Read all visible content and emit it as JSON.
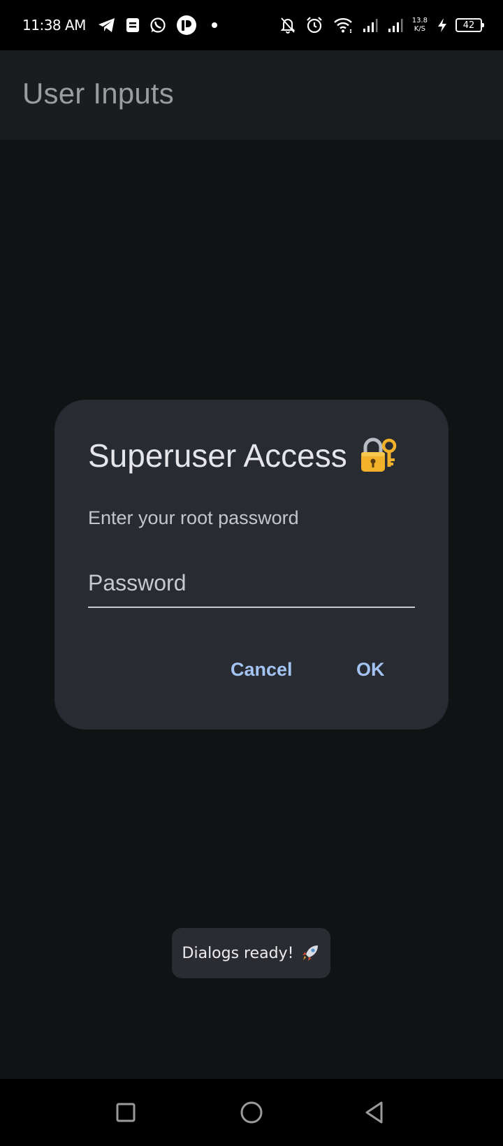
{
  "status_bar": {
    "time": "11:38 AM",
    "left_icons": [
      "telegram-icon",
      "notes-icon",
      "whatsapp-icon",
      "app-icon",
      "notification-dot"
    ],
    "right_icons": [
      "mute-bell-icon",
      "alarm-icon",
      "wifi-icon",
      "signal-icon",
      "signal-icon",
      "speed-indicator",
      "charging-icon",
      "battery-icon"
    ],
    "net_speed_value": "13.8",
    "net_speed_unit": "K/S",
    "battery_level": "42"
  },
  "app_bar": {
    "title": "User Inputs"
  },
  "dialog": {
    "title": "Superuser Access",
    "title_icon": "lock-with-key-icon",
    "message": "Enter your root password",
    "password_field": {
      "placeholder": "Password",
      "value": ""
    },
    "buttons": {
      "cancel": "Cancel",
      "ok": "OK"
    }
  },
  "toast": {
    "text": "Dialogs ready!",
    "icon": "rocket-icon"
  },
  "nav_bar": {
    "buttons": [
      "recent-apps",
      "home",
      "back"
    ]
  },
  "colors": {
    "background": "#111214",
    "app_bar": "#1a1c1f",
    "dialog": "#282b32",
    "accent": "#a3c4f2",
    "toast": "#2a2c31"
  }
}
